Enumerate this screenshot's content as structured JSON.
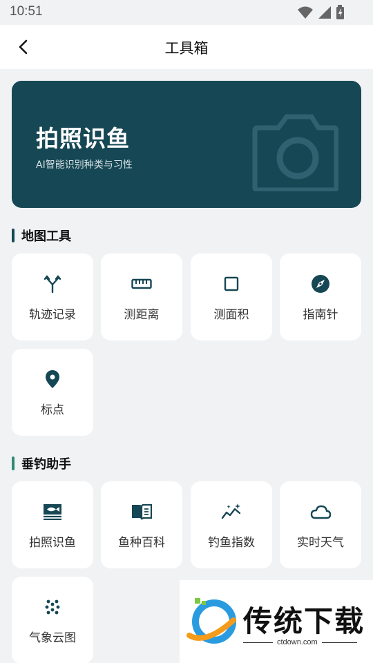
{
  "status_bar": {
    "time": "10:51"
  },
  "header": {
    "title": "工具箱"
  },
  "banner": {
    "title": "拍照识鱼",
    "subtitle": "AI智能识别种类与习性"
  },
  "sections": [
    {
      "title": "地图工具",
      "items": [
        {
          "label": "轨迹记录",
          "icon": "track-icon"
        },
        {
          "label": "测距离",
          "icon": "ruler-icon"
        },
        {
          "label": "测面积",
          "icon": "square-icon"
        },
        {
          "label": "指南针",
          "icon": "compass-icon"
        },
        {
          "label": "标点",
          "icon": "location-pin-icon"
        }
      ]
    },
    {
      "title": "垂钓助手",
      "items": [
        {
          "label": "拍照识鱼",
          "icon": "fish-scan-icon"
        },
        {
          "label": "鱼种百科",
          "icon": "book-icon"
        },
        {
          "label": "钓鱼指数",
          "icon": "chart-sparkle-icon"
        },
        {
          "label": "实时天气",
          "icon": "cloud-icon"
        },
        {
          "label": "气象云图",
          "icon": "dots-grid-icon"
        }
      ]
    }
  ],
  "watermark": {
    "brand": "传统下载",
    "url": "ctdown.com"
  },
  "colors": {
    "accent": "#164754",
    "section_bar_alt": "#2e8a73",
    "background": "#f1f2f4"
  }
}
